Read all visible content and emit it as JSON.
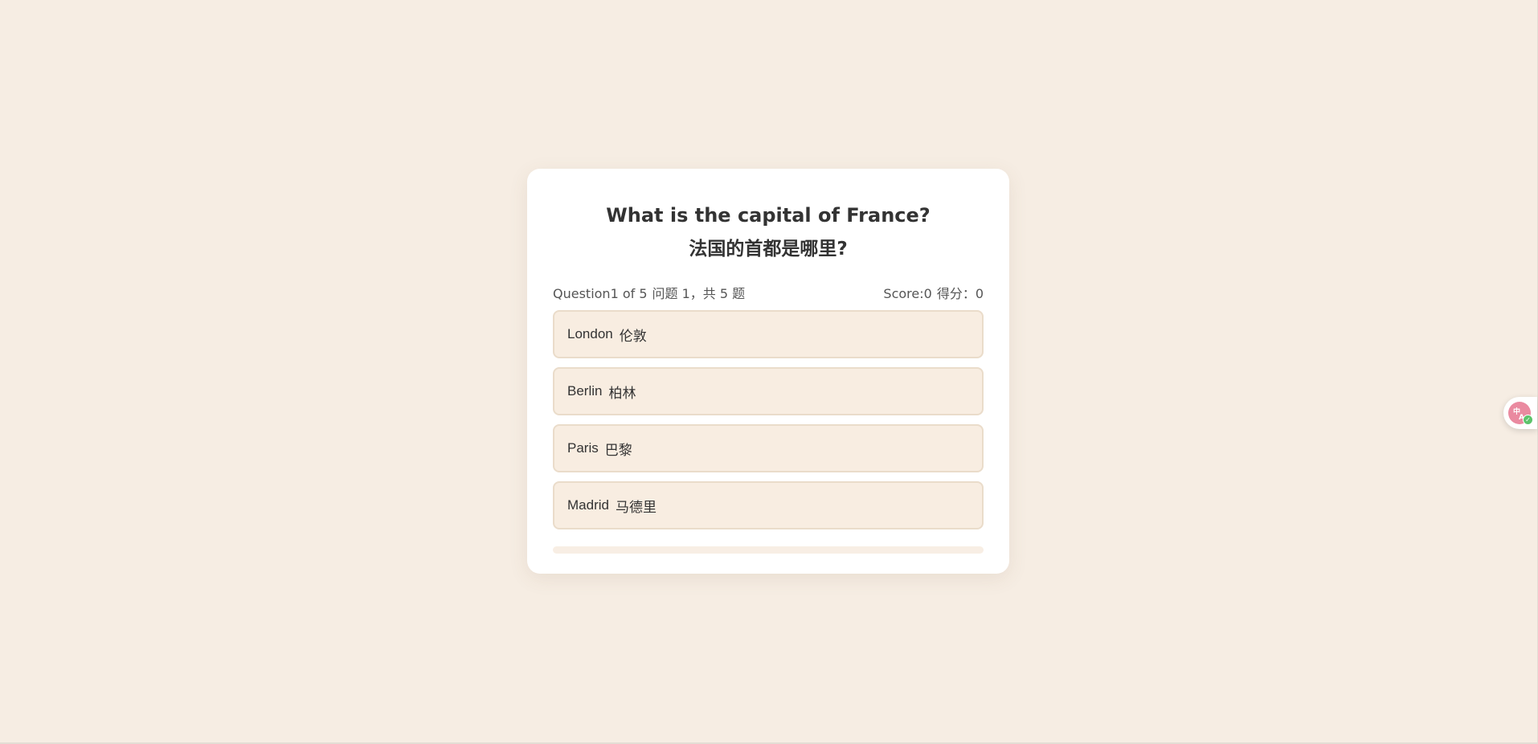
{
  "quiz": {
    "question_en": "What is the capital of France?",
    "question_cn": "法国的首都是哪里?",
    "progress_en": "Question1 of 5",
    "progress_cn": "问题 1，共 5 题",
    "score_en": "Score:0",
    "score_cn": "得分：0",
    "options": [
      {
        "en": "London",
        "cn": "伦敦"
      },
      {
        "en": "Berlin",
        "cn": "柏林"
      },
      {
        "en": "Paris",
        "cn": "巴黎"
      },
      {
        "en": "Madrid",
        "cn": "马德里"
      }
    ],
    "progress_fraction": 0
  },
  "translate_widget": {
    "icon": "translate-icon",
    "status_icon": "check-icon"
  },
  "colors": {
    "background": "#f6ede3",
    "card": "#ffffff",
    "option_bg": "#f8ede1",
    "option_border": "#eadcca",
    "text": "#333333",
    "translate_accent": "#ea8aa0",
    "check_green": "#5cc36b"
  }
}
